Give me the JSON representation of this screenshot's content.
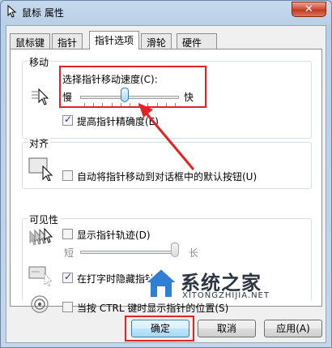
{
  "window": {
    "title": "鼠标 属性",
    "close_glyph": "✕"
  },
  "tabs": [
    {
      "label": "鼠标键"
    },
    {
      "label": "指针"
    },
    {
      "label": "指针选项"
    },
    {
      "label": "滑轮"
    },
    {
      "label": "硬件"
    }
  ],
  "motion": {
    "title": "移动",
    "speed_label": "选择指针移动速度(C):",
    "slow_label": "慢",
    "fast_label": "快",
    "speed_value_percent": 45,
    "precision": {
      "label": "提高指针精确度(E)",
      "checked": true
    }
  },
  "snap": {
    "title": "对齐",
    "option": {
      "label": "自动将指针移动到对话框中的默认按钮(U)",
      "checked": false
    }
  },
  "visibility": {
    "title": "可见性",
    "trails": {
      "label": "显示指针轨迹(D)",
      "checked": false
    },
    "short_label": "短",
    "long_label": "长",
    "trail_value_percent": 100,
    "hide_typing": {
      "label": "在打字时隐藏指针(H)",
      "checked": true
    },
    "ctrl_location": {
      "label": "当按 CTRL 键时显示指针的位置(S)",
      "checked": false
    }
  },
  "buttons": {
    "ok": "确定",
    "cancel": "取消",
    "apply": "应用(A)"
  },
  "watermark": {
    "title": "系统之家",
    "url": "XITONGZHIJIA.NET"
  },
  "colors": {
    "annotation_red": "#e02424",
    "accent_blue": "#3c7fb1"
  }
}
